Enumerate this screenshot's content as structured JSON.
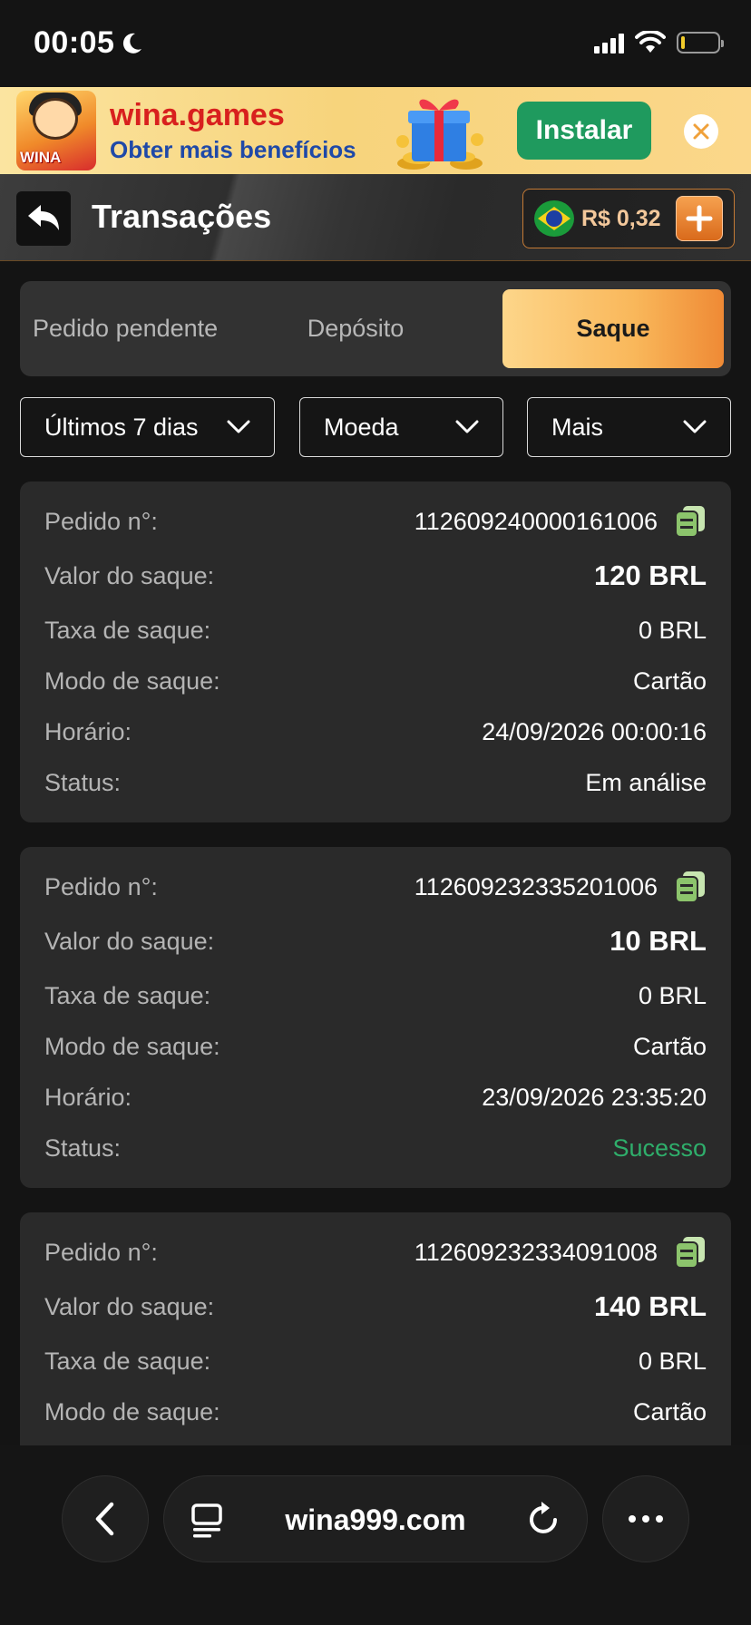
{
  "status_bar": {
    "time": "00:05"
  },
  "banner": {
    "app_icon_text": "WINA",
    "title": "wina.games",
    "subtitle": "Obter mais benefícios",
    "install_label": "Instalar"
  },
  "header": {
    "title": "Transações",
    "balance": "R$ 0,32"
  },
  "tabs": [
    {
      "label": "Pedido pendente",
      "active": false
    },
    {
      "label": "Depósito",
      "active": false
    },
    {
      "label": "Saque",
      "active": true
    }
  ],
  "filters": {
    "period": "Últimos 7 dias",
    "currency": "Moeda",
    "more": "Mais"
  },
  "labels": {
    "order": "Pedido n°:",
    "amount": "Valor do saque:",
    "fee": "Taxa de saque:",
    "mode": "Modo de saque:",
    "time": "Horário:",
    "status": "Status:"
  },
  "transactions": [
    {
      "order": "112609240000161006",
      "amount": "120 BRL",
      "fee": "0 BRL",
      "mode": "Cartão",
      "time": "24/09/2026 00:00:16",
      "status": "Em análise"
    },
    {
      "order": "112609232335201006",
      "amount": "10 BRL",
      "fee": "0 BRL",
      "mode": "Cartão",
      "time": "23/09/2026 23:35:20",
      "status": "Sucesso"
    },
    {
      "order": "112609232334091008",
      "amount": "140 BRL",
      "fee": "0 BRL",
      "mode": "Cartão"
    }
  ],
  "browser": {
    "url": "wina999.com"
  },
  "colors": {
    "accent_orange": "#ef8a35",
    "success_green": "#2fae6b",
    "install_green": "#1f9a5e",
    "card_bg": "#2a2a2a"
  }
}
